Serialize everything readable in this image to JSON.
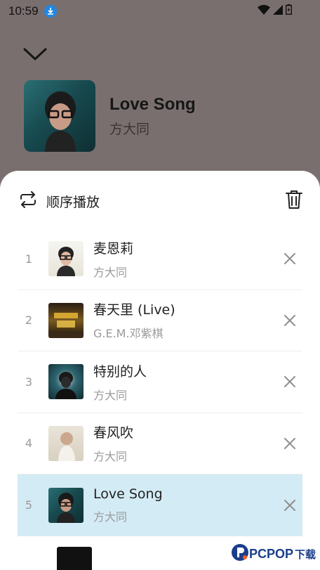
{
  "status_bar": {
    "time": "10:59"
  },
  "now_playing": {
    "title": "Love Song",
    "artist": "方大同"
  },
  "sheet": {
    "mode_label": "顺序播放"
  },
  "queue": [
    {
      "index": "1",
      "title": "麦恩莉",
      "artist": "方大同",
      "active": false
    },
    {
      "index": "2",
      "title": "春天里 (Live)",
      "artist": "G.E.M.邓紫棋",
      "active": false
    },
    {
      "index": "3",
      "title": "特别的人",
      "artist": "方大同",
      "active": false
    },
    {
      "index": "4",
      "title": "春风吹",
      "artist": "方大同",
      "active": false
    },
    {
      "index": "5",
      "title": "Love Song",
      "artist": "方大同",
      "active": true
    }
  ],
  "watermark": {
    "logo": "PCPOP",
    "suffix": "下载"
  },
  "colors": {
    "active_row": "#d3ebf5",
    "backdrop": "#7a6f6f",
    "accent_blue": "#1e88e5"
  },
  "icons": [
    "download-icon",
    "wifi-icon",
    "signal-icon",
    "battery-icon",
    "chevron-down-icon",
    "repeat-icon",
    "trash-icon",
    "close-icon"
  ]
}
